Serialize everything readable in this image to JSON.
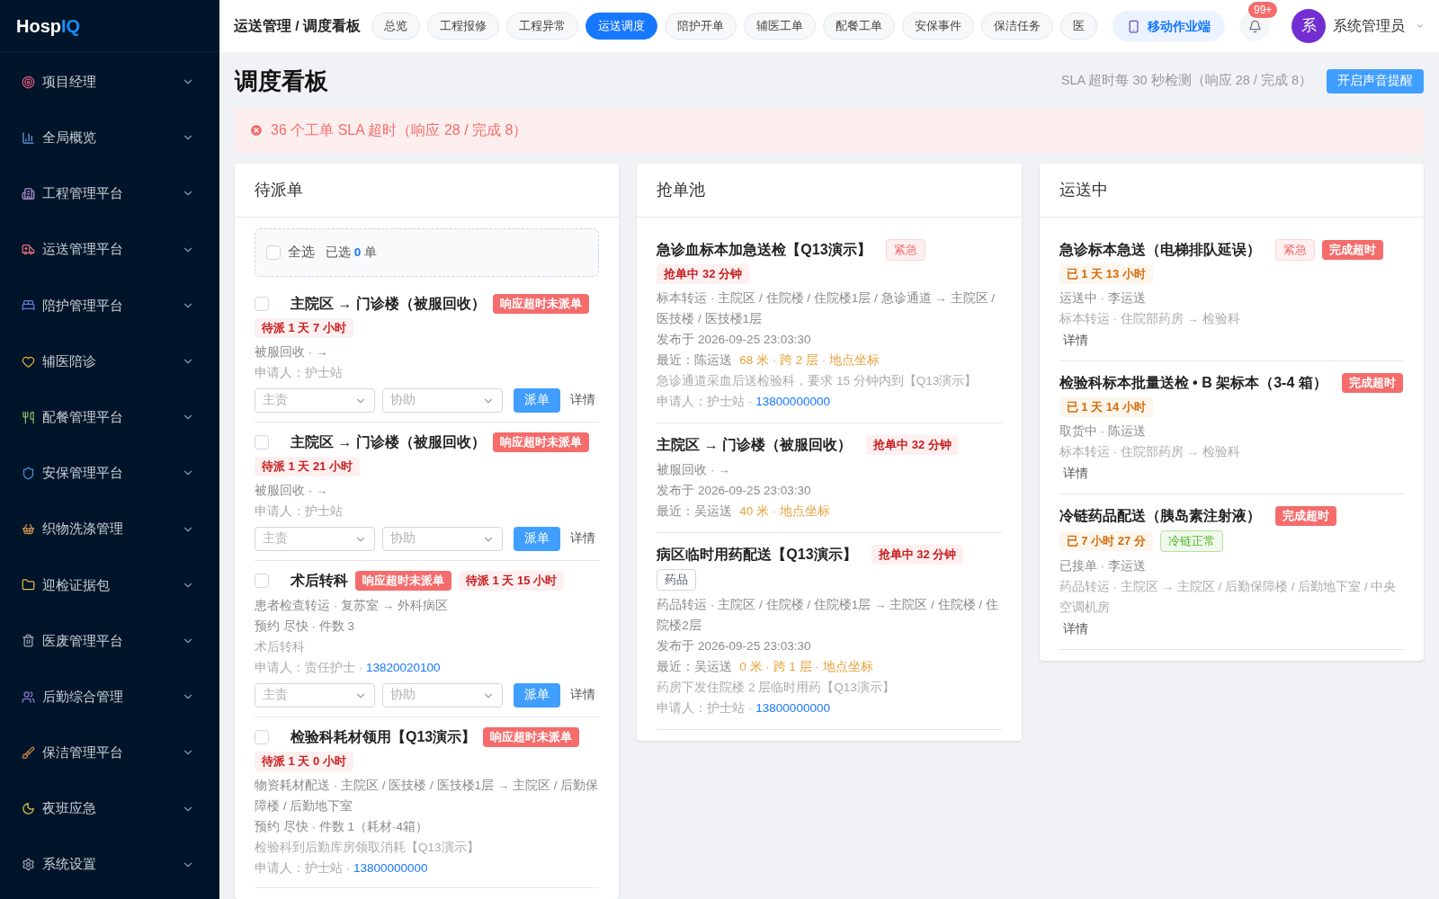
{
  "logo": {
    "main": "Hosp",
    "accent": "IQ"
  },
  "sidebar": {
    "items": [
      {
        "label": "项目经理",
        "expanded": false
      },
      {
        "label": "全局概览",
        "expanded": false
      },
      {
        "label": "工程管理平台",
        "expanded": false
      },
      {
        "label": "运送管理平台",
        "expanded": false
      },
      {
        "label": "陪护管理平台",
        "expanded": false
      },
      {
        "label": "辅医陪诊",
        "expanded": false
      },
      {
        "label": "配餐管理平台",
        "expanded": false
      },
      {
        "label": "安保管理平台",
        "expanded": false
      },
      {
        "label": "织物洗涤管理",
        "expanded": false
      },
      {
        "label": "迎检证据包",
        "expanded": false
      },
      {
        "label": "医废管理平台",
        "expanded": false
      },
      {
        "label": "后勤综合管理",
        "expanded": false
      },
      {
        "label": "保洁管理平台",
        "expanded": false
      },
      {
        "label": "夜班应急",
        "expanded": false
      },
      {
        "label": "系统设置",
        "expanded": false
      }
    ]
  },
  "breadcrumb": "运送管理 / 调度看板",
  "tabs": [
    {
      "label": "总览",
      "selected": false
    },
    {
      "label": "工程报修",
      "selected": false
    },
    {
      "label": "工程异常",
      "selected": false
    },
    {
      "label": "运送调度",
      "selected": true
    },
    {
      "label": "陪护开单",
      "selected": false
    },
    {
      "label": "辅医工单",
      "selected": false
    },
    {
      "label": "配餐工单",
      "selected": false
    },
    {
      "label": "安保事件",
      "selected": false
    },
    {
      "label": "保洁任务",
      "selected": false
    },
    {
      "label": "医",
      "selected": false
    }
  ],
  "mobile_button": "移动作业端",
  "notifications": {
    "badge": "99+"
  },
  "user": {
    "avatar": "系",
    "name": "系统管理员"
  },
  "page": {
    "title": "调度看板",
    "sla_info": "SLA 超时每 30 秒检测（响应 28 / 完成 8）",
    "sound_button": "开启声音提醒"
  },
  "alert": {
    "text": "36 个工单 SLA 超时（响应 28 / 完成 8）"
  },
  "columns": [
    {
      "kind": "pending",
      "title": "待派单",
      "select_all": {
        "label": "全选",
        "checked": false,
        "prefix": "已选",
        "count": "0",
        "suffix": "单"
      },
      "items": [
        {
          "checked": false,
          "title": "主院区 → 门诊楼（被服回收）",
          "tags": [
            {
              "kind": "overdue",
              "text": "响应超时未派单"
            },
            {
              "kind": "waiting",
              "text": "待派 1 天 7 小时"
            }
          ],
          "lines": [
            {
              "kind": "info",
              "text": "被服回收 · →"
            },
            {
              "kind": "faint",
              "text": "申请人：护士站"
            }
          ],
          "actions": {
            "lead": "主责",
            "assist": "协助",
            "dispatch": "派单",
            "detail": "详情"
          }
        },
        {
          "checked": false,
          "title": "主院区 → 门诊楼（被服回收）",
          "tags": [
            {
              "kind": "overdue",
              "text": "响应超时未派单"
            },
            {
              "kind": "waiting",
              "text": "待派 1 天 21 小时"
            }
          ],
          "lines": [
            {
              "kind": "info",
              "text": "被服回收 · →"
            },
            {
              "kind": "faint",
              "text": "申请人：护士站"
            }
          ],
          "actions": {
            "lead": "主责",
            "assist": "协助",
            "dispatch": "派单",
            "detail": "详情"
          }
        },
        {
          "checked": false,
          "title": "术后转科",
          "tags": [
            {
              "kind": "overdue",
              "text": "响应超时未派单"
            },
            {
              "kind": "waiting",
              "text": "待派 1 天 15 小时"
            }
          ],
          "lines": [
            {
              "kind": "info",
              "text": "患者检查转运 · 复苏室 → 外科病区"
            },
            {
              "kind": "info",
              "text": "预约 尽快 · 件数 3"
            },
            {
              "kind": "faint",
              "text": "术后转科"
            },
            {
              "kind": "faint",
              "text": "申请人：责任护士 · ",
              "phone": "13820020100"
            }
          ],
          "actions": {
            "lead": "主责",
            "assist": "协助",
            "dispatch": "派单",
            "detail": "详情"
          }
        },
        {
          "checked": false,
          "title": "检验科耗材领用【Q13演示】",
          "tags": [
            {
              "kind": "overdue",
              "text": "响应超时未派单"
            },
            {
              "kind": "waiting",
              "text": "待派 1 天 0 小时"
            }
          ],
          "lines": [
            {
              "kind": "info",
              "text": "物资耗材配送 · 主院区 / 医技楼 / 医技楼1层 → 主院区 / 后勤保障楼 / 后勤地下室"
            },
            {
              "kind": "info",
              "text": "预约 尽快 · 件数 1（耗材·4箱）"
            },
            {
              "kind": "faint",
              "text": "检验科到后勤库房领取消耗【Q13演示】"
            },
            {
              "kind": "faint",
              "text": "申请人：护士站 · ",
              "phone": "13800000000"
            }
          ]
        }
      ]
    },
    {
      "kind": "pool",
      "title": "抢单池",
      "items": [
        {
          "title": "急诊血标本加急送检【Q13演示】",
          "tags": [
            {
              "kind": "urgent",
              "text": "紧急"
            },
            {
              "kind": "waiting",
              "text": "抢单中 32 分钟"
            }
          ],
          "lines": [
            {
              "kind": "info",
              "text": "标本转运 · 主院区 / 住院楼 / 住院楼1层 / 急诊通道 → 主院区 / 医技楼 / 医技楼1层"
            },
            {
              "kind": "info",
              "text": "发布于 2026-09-25 23:03:30"
            },
            {
              "kind": "info",
              "text": "最近：陈运送",
              "accent": "68 米 · 跨 2 层 · 地点坐标"
            },
            {
              "kind": "faint",
              "text": "急诊通道采血后送检验科，要求 15 分钟内到【Q13演示】"
            },
            {
              "kind": "faint",
              "text": "申请人：护士站 · ",
              "phone": "13800000000"
            }
          ]
        },
        {
          "title": "主院区 → 门诊楼（被服回收）",
          "tags": [
            {
              "kind": "waiting",
              "text": "抢单中 32 分钟"
            }
          ],
          "lines": [
            {
              "kind": "info",
              "text": "被服回收 · →"
            },
            {
              "kind": "info",
              "text": "发布于 2026-09-25 23:03:30"
            },
            {
              "kind": "info",
              "text": "最近：吴运送",
              "accent": "40 米 · 地点坐标"
            }
          ]
        },
        {
          "title": "病区临时用药配送【Q13演示】",
          "tags": [
            {
              "kind": "waiting",
              "text": "抢单中 32 分钟"
            },
            {
              "kind": "plain",
              "text": "药品"
            }
          ],
          "lines": [
            {
              "kind": "info",
              "text": "药品转运 · 主院区 / 住院楼 / 住院楼1层 → 主院区 / 住院楼 / 住院楼2层"
            },
            {
              "kind": "info",
              "text": "发布于 2026-09-25 23:03:30"
            },
            {
              "kind": "info",
              "text": "最近：吴运送",
              "accent": "0 米 · 跨 1 层 · 地点坐标"
            },
            {
              "kind": "faint",
              "text": "药房下发住院楼 2 层临时用药【Q13演示】"
            },
            {
              "kind": "faint",
              "text": "申请人：护士站 · ",
              "phone": "13800000000"
            }
          ]
        }
      ]
    },
    {
      "kind": "transit",
      "title": "运送中",
      "items": [
        {
          "title": "急诊标本急送（电梯排队延误）",
          "tags": [
            {
              "kind": "urgent",
              "text": "紧急"
            },
            {
              "kind": "overdue",
              "text": "完成超时"
            },
            {
              "kind": "elapsed",
              "text": "已 1 天 13 小时"
            }
          ],
          "lines": [
            {
              "kind": "info",
              "text": "运送中 · 李运送"
            },
            {
              "kind": "faint",
              "text": "标本转运 · 住院部药房 → 检验科"
            }
          ],
          "detail": "详情"
        },
        {
          "title": "检验科标本批量送检 • B 架标本（3-4 箱）",
          "tags": [
            {
              "kind": "overdue",
              "text": "完成超时"
            },
            {
              "kind": "elapsed",
              "text": "已 1 天 14 小时"
            }
          ],
          "lines": [
            {
              "kind": "info",
              "text": "取货中 · 陈运送"
            },
            {
              "kind": "faint",
              "text": "标本转运 · 住院部药房 → 检验科"
            }
          ],
          "detail": "详情"
        },
        {
          "title": "冷链药品配送（胰岛素注射液）",
          "tags": [
            {
              "kind": "overdue",
              "text": "完成超时"
            },
            {
              "kind": "elapsed",
              "text": "已 7 小时 27 分"
            },
            {
              "kind": "ok",
              "text": "冷链正常"
            }
          ],
          "lines": [
            {
              "kind": "info",
              "text": "已接单 · 李运送"
            },
            {
              "kind": "faint",
              "text": "药品转运 · 主院区 → 主院区 / 后勤保障楼 / 后勤地下室 / 中央空调机房"
            }
          ],
          "detail": "详情"
        }
      ]
    }
  ]
}
